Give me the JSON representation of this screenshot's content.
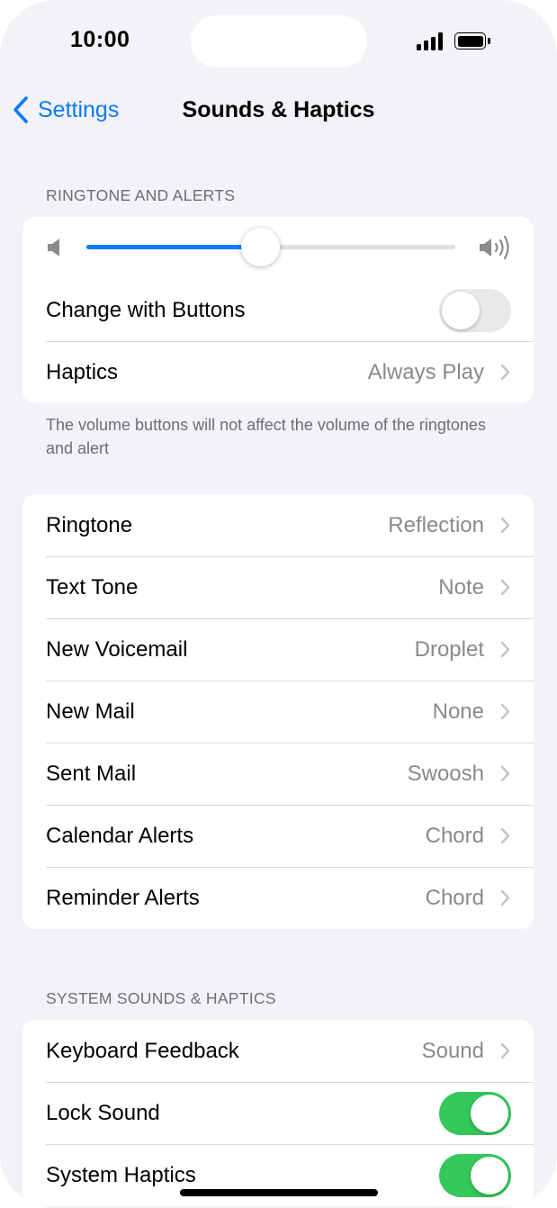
{
  "status_bar": {
    "time": "10:00"
  },
  "nav": {
    "back_label": "Settings",
    "title": "Sounds & Haptics"
  },
  "ringtone_section": {
    "header": "RINGTONE AND ALERTS",
    "volume_level": 0.47,
    "change_with_buttons": {
      "label": "Change with Buttons",
      "on": false
    },
    "haptics": {
      "label": "Haptics",
      "value": "Always Play"
    },
    "footer": "The volume buttons will not affect the volume of the ringtones and alert"
  },
  "tones": [
    {
      "label": "Ringtone",
      "value": "Reflection"
    },
    {
      "label": "Text Tone",
      "value": "Note"
    },
    {
      "label": "New Voicemail",
      "value": "Droplet"
    },
    {
      "label": "New Mail",
      "value": "None"
    },
    {
      "label": "Sent Mail",
      "value": "Swoosh"
    },
    {
      "label": "Calendar Alerts",
      "value": "Chord"
    },
    {
      "label": "Reminder Alerts",
      "value": "Chord"
    }
  ],
  "system_section": {
    "header": "SYSTEM SOUNDS & HAPTICS",
    "keyboard_feedback": {
      "label": "Keyboard Feedback",
      "value": "Sound"
    },
    "lock_sound": {
      "label": "Lock Sound",
      "on": true
    },
    "system_haptics": {
      "label": "System Haptics",
      "on": true
    }
  },
  "colors": {
    "accent": "#0a7aff",
    "toggle_on": "#34c759",
    "background": "#f2f2f7"
  },
  "icons": [
    "back-chevron-icon",
    "speaker-low-icon",
    "speaker-high-icon",
    "chevron-right-icon",
    "cellular-signal-icon",
    "battery-icon"
  ]
}
